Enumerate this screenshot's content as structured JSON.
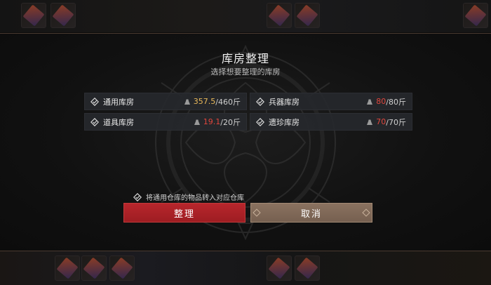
{
  "dialog": {
    "title": "库房整理",
    "subtitle": "选择想要整理的库房"
  },
  "warehouses": [
    {
      "name": "通用库房",
      "current": "357.5",
      "max": "/460斤",
      "current_color": "#e8b85a"
    },
    {
      "name": "兵器库房",
      "current": "80",
      "max": "/80斤",
      "current_color": "#e0463c"
    },
    {
      "name": "道具库房",
      "current": "19.1",
      "max": "/20斤",
      "current_color": "#e0463c"
    },
    {
      "name": "遗珍库房",
      "current": "70",
      "max": "/70斤",
      "current_color": "#e0463c"
    }
  ],
  "option": {
    "label": "将通用仓库的物品转入对应仓库"
  },
  "buttons": {
    "confirm": "整理",
    "cancel": "取消"
  },
  "colors": {
    "confirm_bg": "#b8262c",
    "cancel_bg": "#8a7260",
    "accent_gold": "#e8b85a",
    "accent_red": "#e0463c"
  },
  "icons": {
    "checkbox": "diamond-check-icon",
    "weight": "weight-icon"
  }
}
